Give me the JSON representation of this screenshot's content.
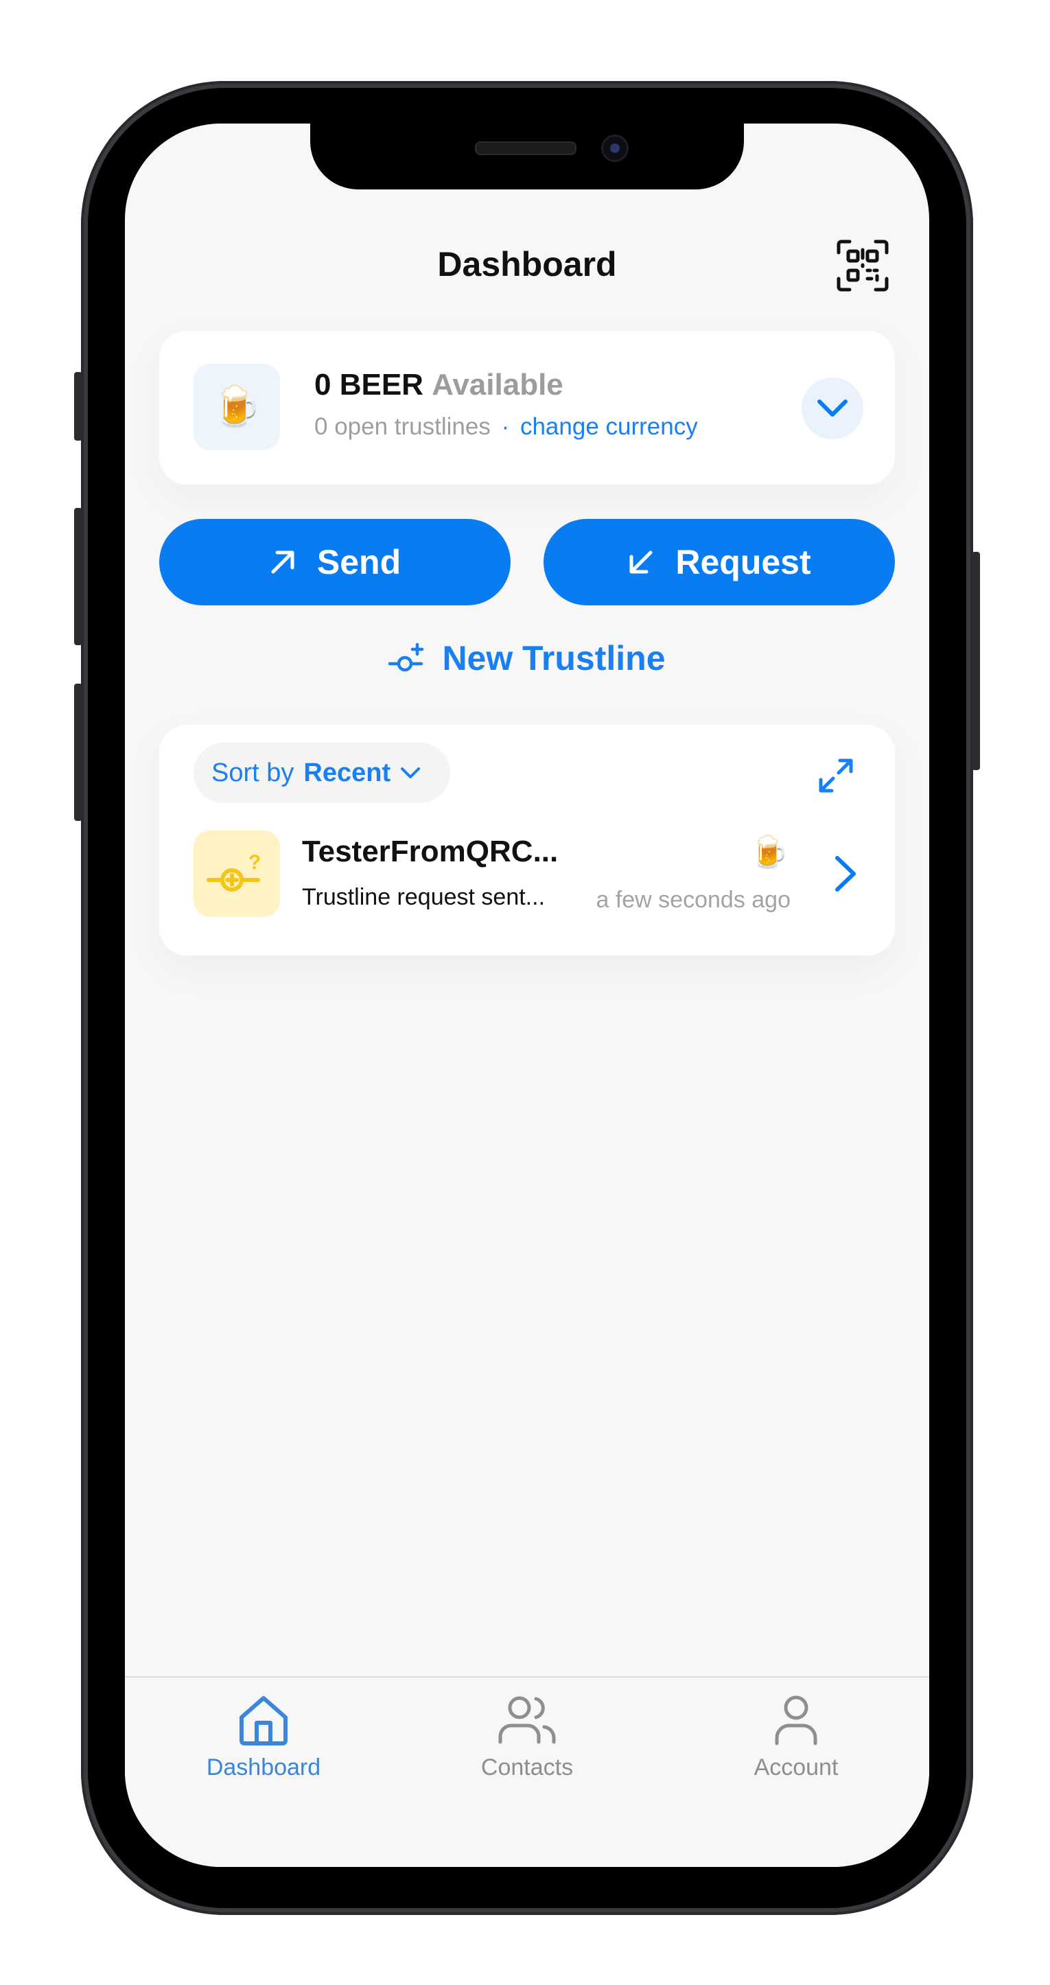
{
  "header": {
    "title": "Dashboard",
    "scan_icon": "qr-scan-icon"
  },
  "balance": {
    "currency_icon": "🍺",
    "amount": "0 BEER",
    "available_label": "Available",
    "open_trustlines": "0 open trustlines",
    "separator": "·",
    "change_currency": "change currency"
  },
  "actions": {
    "send_label": "Send",
    "request_label": "Request",
    "new_trustline_label": "New Trustline"
  },
  "activity": {
    "sort_prefix": "Sort by",
    "sort_value": "Recent",
    "items": [
      {
        "name": "TesterFromQRC...",
        "status": "Trustline request sent...",
        "currency_icon": "🍺",
        "time": "a few seconds ago"
      }
    ]
  },
  "tabbar": {
    "tabs": [
      {
        "label": "Dashboard",
        "icon": "home-icon",
        "active": true
      },
      {
        "label": "Contacts",
        "icon": "contacts-icon",
        "active": false
      },
      {
        "label": "Account",
        "icon": "account-icon",
        "active": false
      }
    ]
  },
  "colors": {
    "accent": "#0a7cf2",
    "link": "#1a7ff0",
    "pending": "#f5c518"
  }
}
